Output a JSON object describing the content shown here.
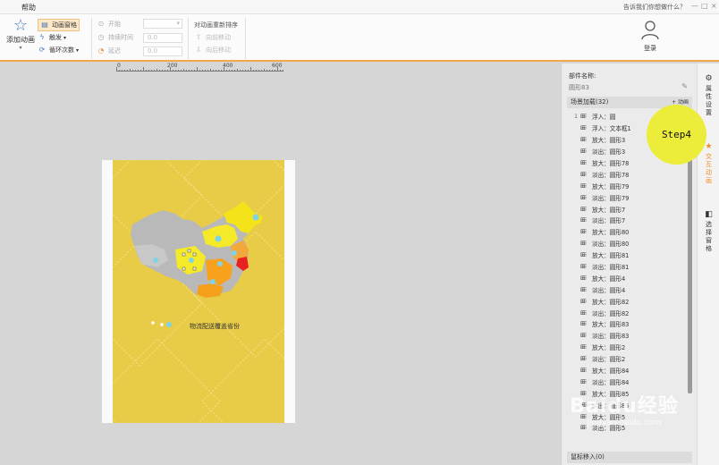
{
  "titlebar": {
    "menu_help": "帮助",
    "tell_me": "告诉我们你想做什么？",
    "win_min": "—",
    "win_max": "□",
    "win_close": "×"
  },
  "ribbon": {
    "add_animation": "添加动画",
    "animation_pane": "动画窗格",
    "trigger": "触发",
    "loop_count": "循环次数",
    "start": "开始",
    "duration": "持续时间",
    "delay": "延迟",
    "duration_value": "0.0",
    "delay_value": "0.0",
    "reorder_title": "对动画重新排序",
    "move_earlier": "向前移动",
    "move_later": "向后移动",
    "login": "登录"
  },
  "ruler": {
    "labels": [
      "0",
      "200",
      "400",
      "600"
    ]
  },
  "slide": {
    "caption": "物流配送覆盖省份"
  },
  "panel": {
    "component_name_label": "部件名称:",
    "component_name_value": "圆形83",
    "scene_load": "场景加载(32)",
    "add_animation": "+ 动画",
    "items": [
      {
        "num": "1",
        "text": "浮入：圆"
      },
      {
        "num": "",
        "text": "浮入：文本框1"
      },
      {
        "num": "",
        "text": "放大：圆形3"
      },
      {
        "num": "",
        "text": "淡出：圆形3"
      },
      {
        "num": "",
        "text": "放大：圆形78"
      },
      {
        "num": "",
        "text": "淡出：圆形78"
      },
      {
        "num": "",
        "text": "放大：圆形79"
      },
      {
        "num": "",
        "text": "淡出：圆形79"
      },
      {
        "num": "",
        "text": "放大：圆形7"
      },
      {
        "num": "",
        "text": "淡出：圆形7"
      },
      {
        "num": "",
        "text": "放大：圆形80"
      },
      {
        "num": "",
        "text": "淡出：圆形80"
      },
      {
        "num": "",
        "text": "放大：圆形81"
      },
      {
        "num": "",
        "text": "淡出：圆形81"
      },
      {
        "num": "",
        "text": "放大：圆形4"
      },
      {
        "num": "",
        "text": "淡出：圆形4"
      },
      {
        "num": "",
        "text": "放大：圆形82"
      },
      {
        "num": "",
        "text": "淡出：圆形82"
      },
      {
        "num": "",
        "text": "放大：圆形83"
      },
      {
        "num": "",
        "text": "淡出：圆形83"
      },
      {
        "num": "",
        "text": "放大：圆形2"
      },
      {
        "num": "",
        "text": "淡出：圆形2"
      },
      {
        "num": "",
        "text": "放大：圆形84"
      },
      {
        "num": "",
        "text": "淡出：圆形84"
      },
      {
        "num": "",
        "text": "放大：圆形85"
      },
      {
        "num": "",
        "text": "淡出：圆形85"
      },
      {
        "num": "",
        "text": "放大：圆形5"
      },
      {
        "num": "",
        "text": "淡出：圆形5"
      }
    ],
    "mouse_enter": "鼠标移入(0)"
  },
  "rail": {
    "properties": "属性设置",
    "animation": "交互动画",
    "selection": "选择窗格"
  },
  "step_badge": "Step4",
  "watermark": {
    "big": "Baidu经验",
    "small": "jingyan.baidu.com"
  },
  "colors": {
    "accent": "#f08c2a",
    "slide_bg": "#e8cc47",
    "badge": "#ecec3a"
  }
}
